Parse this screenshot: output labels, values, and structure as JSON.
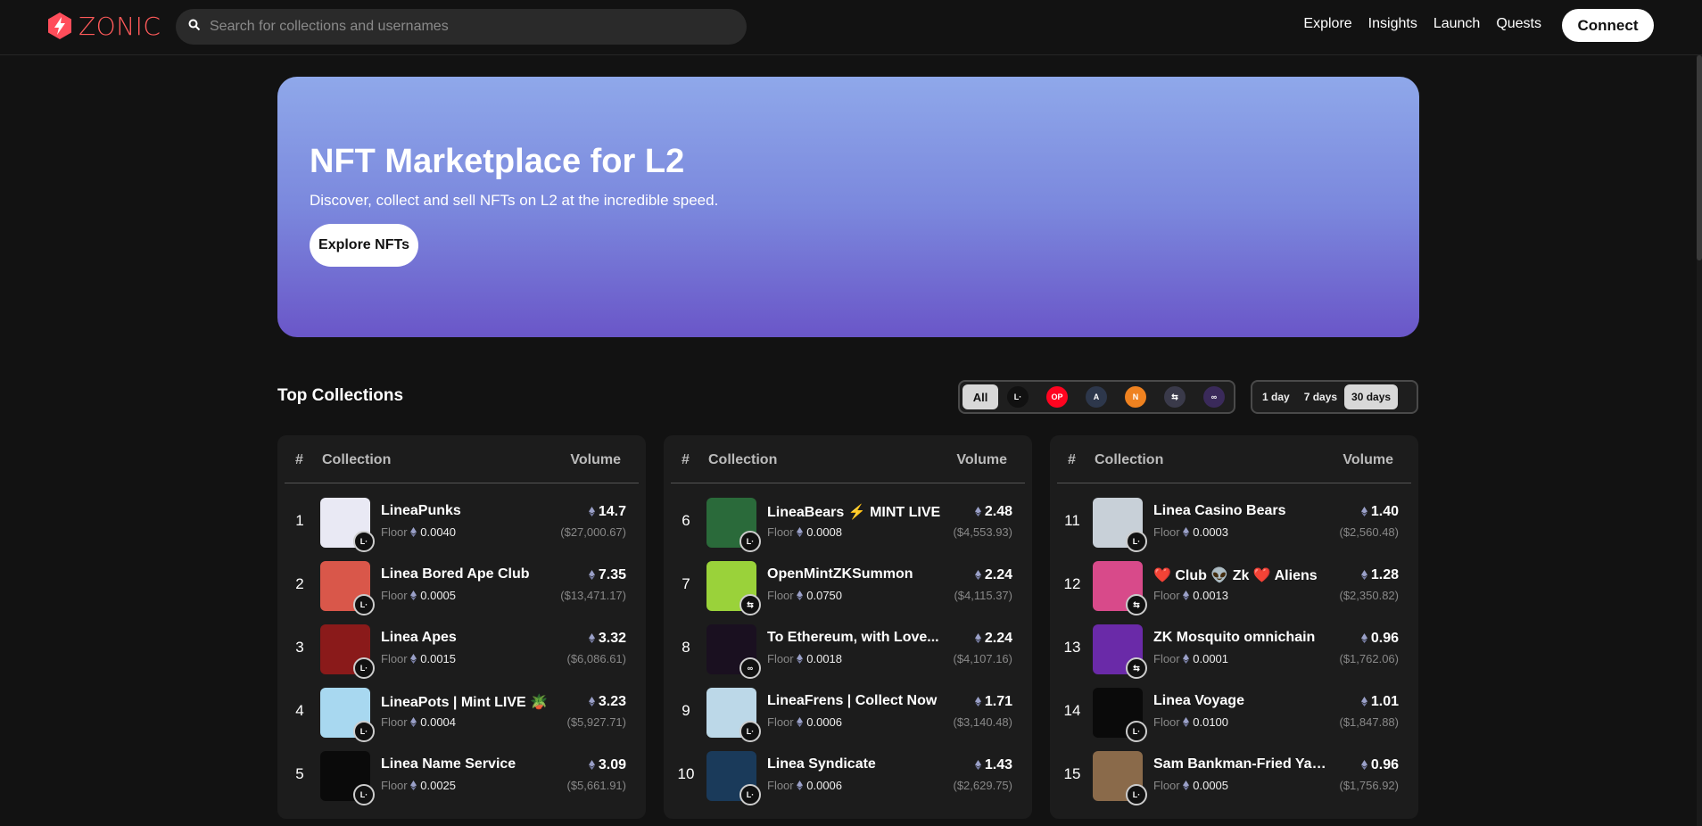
{
  "header": {
    "logo_text": "ZONIC",
    "search_placeholder": "Search for collections and usernames",
    "nav": [
      "Explore",
      "Insights",
      "Launch",
      "Quests"
    ],
    "connect_label": "Connect"
  },
  "hero": {
    "title": "NFT Marketplace for L2",
    "subtitle": "Discover, collect and sell NFTs on L2 at the incredible speed.",
    "button": "Explore NFTs"
  },
  "top": {
    "title": "Top Collections",
    "chain_filter": {
      "all_label": "All",
      "chains": [
        {
          "name": "linea",
          "bg": "#111111",
          "glyph": "L·"
        },
        {
          "name": "optimism",
          "bg": "#ff0420",
          "glyph": "OP"
        },
        {
          "name": "arbitrum",
          "bg": "#2d374b",
          "glyph": "A"
        },
        {
          "name": "arbitrum-nova",
          "bg": "#ef8220",
          "glyph": "N"
        },
        {
          "name": "zksync",
          "bg": "#3a3a4a",
          "glyph": "⇆"
        },
        {
          "name": "polygon-zkevm",
          "bg": "#3a2a5a",
          "glyph": "∞"
        }
      ]
    },
    "time_filter": [
      "1 day",
      "7 days",
      "30 days"
    ],
    "active_time": "30 days",
    "headers": {
      "num": "#",
      "collection": "Collection",
      "volume": "Volume"
    },
    "floor_label": "Floor",
    "columns": [
      [
        {
          "rank": "1",
          "name": "LineaPunks",
          "floor": "0.0040",
          "volume": "14.7",
          "usd": "($27,000.67)",
          "chain": "linea",
          "thumb": "#e9e9f4"
        },
        {
          "rank": "2",
          "name": "Linea Bored Ape Club",
          "floor": "0.0005",
          "volume": "7.35",
          "usd": "($13,471.17)",
          "chain": "linea",
          "thumb": "#d9574a"
        },
        {
          "rank": "3",
          "name": "Linea Apes",
          "floor": "0.0015",
          "volume": "3.32",
          "usd": "($6,086.61)",
          "chain": "linea",
          "thumb": "#8a1a1a"
        },
        {
          "rank": "4",
          "name": "LineaPots | Mint LIVE 🪴",
          "floor": "0.0004",
          "volume": "3.23",
          "usd": "($5,927.71)",
          "chain": "linea",
          "thumb": "#a8d8f0"
        },
        {
          "rank": "5",
          "name": "Linea Name Service",
          "floor": "0.0025",
          "volume": "3.09",
          "usd": "($5,661.91)",
          "chain": "linea",
          "thumb": "#0a0a0a"
        }
      ],
      [
        {
          "rank": "6",
          "name": "LineaBears ⚡ MINT LIVE",
          "floor": "0.0008",
          "volume": "2.48",
          "usd": "($4,553.93)",
          "chain": "linea",
          "thumb": "#2a6a3a"
        },
        {
          "rank": "7",
          "name": "OpenMintZKSummon",
          "floor": "0.0750",
          "volume": "2.24",
          "usd": "($4,115.37)",
          "chain": "zksync",
          "thumb": "#9ad23a"
        },
        {
          "rank": "8",
          "name": "To Ethereum, with Love...",
          "floor": "0.0018",
          "volume": "2.24",
          "usd": "($4,107.16)",
          "chain": "polygon-zkevm",
          "thumb": "#1a1020"
        },
        {
          "rank": "9",
          "name": "LineaFrens | Collect Now",
          "floor": "0.0006",
          "volume": "1.71",
          "usd": "($3,140.48)",
          "chain": "linea",
          "thumb": "#bcd8e8"
        },
        {
          "rank": "10",
          "name": "Linea Syndicate",
          "floor": "0.0006",
          "volume": "1.43",
          "usd": "($2,629.75)",
          "chain": "linea",
          "thumb": "#1a3a5a"
        }
      ],
      [
        {
          "rank": "11",
          "name": "Linea Casino Bears",
          "floor": "0.0003",
          "volume": "1.40",
          "usd": "($2,560.48)",
          "chain": "linea",
          "thumb": "#c8d0d8"
        },
        {
          "rank": "12",
          "name": "❤️ Club 👽 Zk ❤️ Aliens",
          "floor": "0.0013",
          "volume": "1.28",
          "usd": "($2,350.82)",
          "chain": "zksync",
          "thumb": "#d84a8a"
        },
        {
          "rank": "13",
          "name": "ZK Mosquito omnichain",
          "floor": "0.0001",
          "volume": "0.96",
          "usd": "($1,762.06)",
          "chain": "zksync",
          "thumb": "#6a2aa8"
        },
        {
          "rank": "14",
          "name": "Linea Voyage",
          "floor": "0.0100",
          "volume": "1.01",
          "usd": "($1,847.88)",
          "chain": "linea",
          "thumb": "#0a0a0a"
        },
        {
          "rank": "15",
          "name": "Sam Bankman-Fried Yacht Club",
          "floor": "0.0005",
          "volume": "0.96",
          "usd": "($1,756.92)",
          "chain": "linea",
          "thumb": "#8a6a4a"
        }
      ]
    ]
  }
}
